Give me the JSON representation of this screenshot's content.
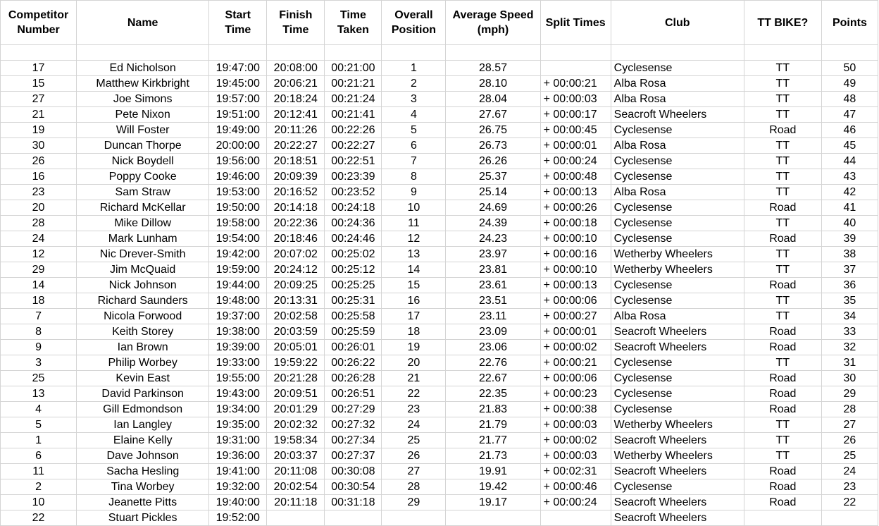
{
  "headers": [
    "Competitor Number",
    "Name",
    "Start Time",
    "Finish Time",
    "Time Taken",
    "Overall Position",
    "Average Speed (mph)",
    "Split Times",
    "Club",
    "TT BIKE?",
    "Points"
  ],
  "rows": [
    [
      "17",
      "Ed Nicholson",
      "19:47:00",
      "20:08:00",
      "00:21:00",
      "1",
      "28.57",
      "",
      "Cyclesense",
      "TT",
      "50"
    ],
    [
      "15",
      "Matthew Kirkbright",
      "19:45:00",
      "20:06:21",
      "00:21:21",
      "2",
      "28.10",
      "+ 00:00:21",
      "Alba Rosa",
      "TT",
      "49"
    ],
    [
      "27",
      "Joe Simons",
      "19:57:00",
      "20:18:24",
      "00:21:24",
      "3",
      "28.04",
      "+ 00:00:03",
      "Alba Rosa",
      "TT",
      "48"
    ],
    [
      "21",
      "Pete Nixon",
      "19:51:00",
      "20:12:41",
      "00:21:41",
      "4",
      "27.67",
      "+ 00:00:17",
      "Seacroft Wheelers",
      "TT",
      "47"
    ],
    [
      "19",
      "Will Foster",
      "19:49:00",
      "20:11:26",
      "00:22:26",
      "5",
      "26.75",
      "+ 00:00:45",
      "Cyclesense",
      "Road",
      "46"
    ],
    [
      "30",
      "Duncan Thorpe",
      "20:00:00",
      "20:22:27",
      "00:22:27",
      "6",
      "26.73",
      "+ 00:00:01",
      "Alba Rosa",
      "TT",
      "45"
    ],
    [
      "26",
      "Nick Boydell",
      "19:56:00",
      "20:18:51",
      "00:22:51",
      "7",
      "26.26",
      "+ 00:00:24",
      "Cyclesense",
      "TT",
      "44"
    ],
    [
      "16",
      "Poppy Cooke",
      "19:46:00",
      "20:09:39",
      "00:23:39",
      "8",
      "25.37",
      "+ 00:00:48",
      "Cyclesense",
      "TT",
      "43"
    ],
    [
      "23",
      "Sam Straw",
      "19:53:00",
      "20:16:52",
      "00:23:52",
      "9",
      "25.14",
      "+ 00:00:13",
      "Alba Rosa",
      "TT",
      "42"
    ],
    [
      "20",
      "Richard McKellar",
      "19:50:00",
      "20:14:18",
      "00:24:18",
      "10",
      "24.69",
      "+ 00:00:26",
      "Cyclesense",
      "Road",
      "41"
    ],
    [
      "28",
      "Mike Dillow",
      "19:58:00",
      "20:22:36",
      "00:24:36",
      "11",
      "24.39",
      "+ 00:00:18",
      "Cyclesense",
      "TT",
      "40"
    ],
    [
      "24",
      "Mark Lunham",
      "19:54:00",
      "20:18:46",
      "00:24:46",
      "12",
      "24.23",
      "+ 00:00:10",
      "Cyclesense",
      "Road",
      "39"
    ],
    [
      "12",
      "Nic Drever-Smith",
      "19:42:00",
      "20:07:02",
      "00:25:02",
      "13",
      "23.97",
      "+ 00:00:16",
      "Wetherby Wheelers",
      "TT",
      "38"
    ],
    [
      "29",
      "Jim McQuaid",
      "19:59:00",
      "20:24:12",
      "00:25:12",
      "14",
      "23.81",
      "+ 00:00:10",
      "Wetherby Wheelers",
      "TT",
      "37"
    ],
    [
      "14",
      "Nick Johnson",
      "19:44:00",
      "20:09:25",
      "00:25:25",
      "15",
      "23.61",
      "+ 00:00:13",
      "Cyclesense",
      "Road",
      "36"
    ],
    [
      "18",
      "Richard Saunders",
      "19:48:00",
      "20:13:31",
      "00:25:31",
      "16",
      "23.51",
      "+ 00:00:06",
      "Cyclesense",
      "TT",
      "35"
    ],
    [
      "7",
      "Nicola Forwood",
      "19:37:00",
      "20:02:58",
      "00:25:58",
      "17",
      "23.11",
      "+ 00:00:27",
      "Alba Rosa",
      "TT",
      "34"
    ],
    [
      "8",
      "Keith Storey",
      "19:38:00",
      "20:03:59",
      "00:25:59",
      "18",
      "23.09",
      "+ 00:00:01",
      "Seacroft Wheelers",
      "Road",
      "33"
    ],
    [
      "9",
      "Ian Brown",
      "19:39:00",
      "20:05:01",
      "00:26:01",
      "19",
      "23.06",
      "+ 00:00:02",
      "Seacroft Wheelers",
      "Road",
      "32"
    ],
    [
      "3",
      "Philip Worbey",
      "19:33:00",
      "19:59:22",
      "00:26:22",
      "20",
      "22.76",
      "+ 00:00:21",
      "Cyclesense",
      "TT",
      "31"
    ],
    [
      "25",
      "Kevin East",
      "19:55:00",
      "20:21:28",
      "00:26:28",
      "21",
      "22.67",
      "+ 00:00:06",
      "Cyclesense",
      "Road",
      "30"
    ],
    [
      "13",
      "David Parkinson",
      "19:43:00",
      "20:09:51",
      "00:26:51",
      "22",
      "22.35",
      "+ 00:00:23",
      "Cyclesense",
      "Road",
      "29"
    ],
    [
      "4",
      "Gill Edmondson",
      "19:34:00",
      "20:01:29",
      "00:27:29",
      "23",
      "21.83",
      "+ 00:00:38",
      "Cyclesense",
      "Road",
      "28"
    ],
    [
      "5",
      "Ian Langley",
      "19:35:00",
      "20:02:32",
      "00:27:32",
      "24",
      "21.79",
      "+ 00:00:03",
      "Wetherby Wheelers",
      "TT",
      "27"
    ],
    [
      "1",
      "Elaine Kelly",
      "19:31:00",
      "19:58:34",
      "00:27:34",
      "25",
      "21.77",
      "+ 00:00:02",
      "Seacroft Wheelers",
      "TT",
      "26"
    ],
    [
      "6",
      "Dave Johnson",
      "19:36:00",
      "20:03:37",
      "00:27:37",
      "26",
      "21.73",
      "+ 00:00:03",
      "Wetherby Wheelers",
      "TT",
      "25"
    ],
    [
      "11",
      "Sacha Hesling",
      "19:41:00",
      "20:11:08",
      "00:30:08",
      "27",
      "19.91",
      "+ 00:02:31",
      "Seacroft Wheelers",
      "Road",
      "24"
    ],
    [
      "2",
      "Tina Worbey",
      "19:32:00",
      "20:02:54",
      "00:30:54",
      "28",
      "19.42",
      "+ 00:00:46",
      "Cyclesense",
      "Road",
      "23"
    ],
    [
      "10",
      "Jeanette Pitts",
      "19:40:00",
      "20:11:18",
      "00:31:18",
      "29",
      "19.17",
      "+ 00:00:24",
      "Seacroft Wheelers",
      "Road",
      "22"
    ],
    [
      "22",
      "Stuart Pickles",
      "19:52:00",
      "",
      "",
      "",
      "",
      "",
      "Seacroft Wheelers",
      "",
      ""
    ]
  ]
}
